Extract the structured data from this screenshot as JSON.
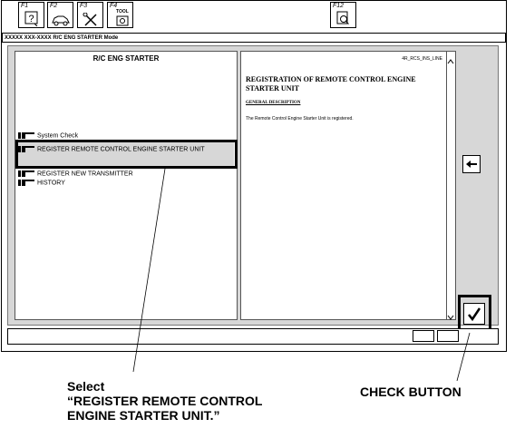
{
  "fkeys": [
    {
      "label": "F1",
      "icon": "help-icon"
    },
    {
      "label": "F2",
      "icon": "car-icon"
    },
    {
      "label": "F3",
      "icon": "tools-icon"
    },
    {
      "label": "F4",
      "icon": "tool-setup-icon",
      "tag": "TOOL"
    },
    {
      "label": "F12",
      "icon": "print-icon"
    }
  ],
  "title": "XXXXX XXX-XXXX R/C ENG STARTER Mode",
  "left": {
    "header": "R/C ENG STARTER",
    "items": [
      {
        "label": "System Check"
      },
      {
        "label": "REGISTER REMOTE CONTROL ENGINE STARTER UNIT"
      },
      {
        "label": "REGISTER NEW TRANSMITTER"
      },
      {
        "label": "HISTORY"
      }
    ]
  },
  "doc": {
    "code": "4R_RCS_INS_LINE",
    "heading": "REGISTRATION OF REMOTE CONTROL ENGINE STARTER UNIT",
    "section": "GENERAL DESCRIPTION",
    "body": "The Remote Control Engine Starter Unit is registered."
  },
  "sidebar": {
    "back_icon": "arrow-left-icon",
    "check_icon": "checkmark-icon"
  },
  "callouts": {
    "select_line1": "Select",
    "select_line2": "“REGISTER REMOTE CONTROL",
    "select_line3": "ENGINE STARTER UNIT.”",
    "check": "CHECK BUTTON"
  }
}
